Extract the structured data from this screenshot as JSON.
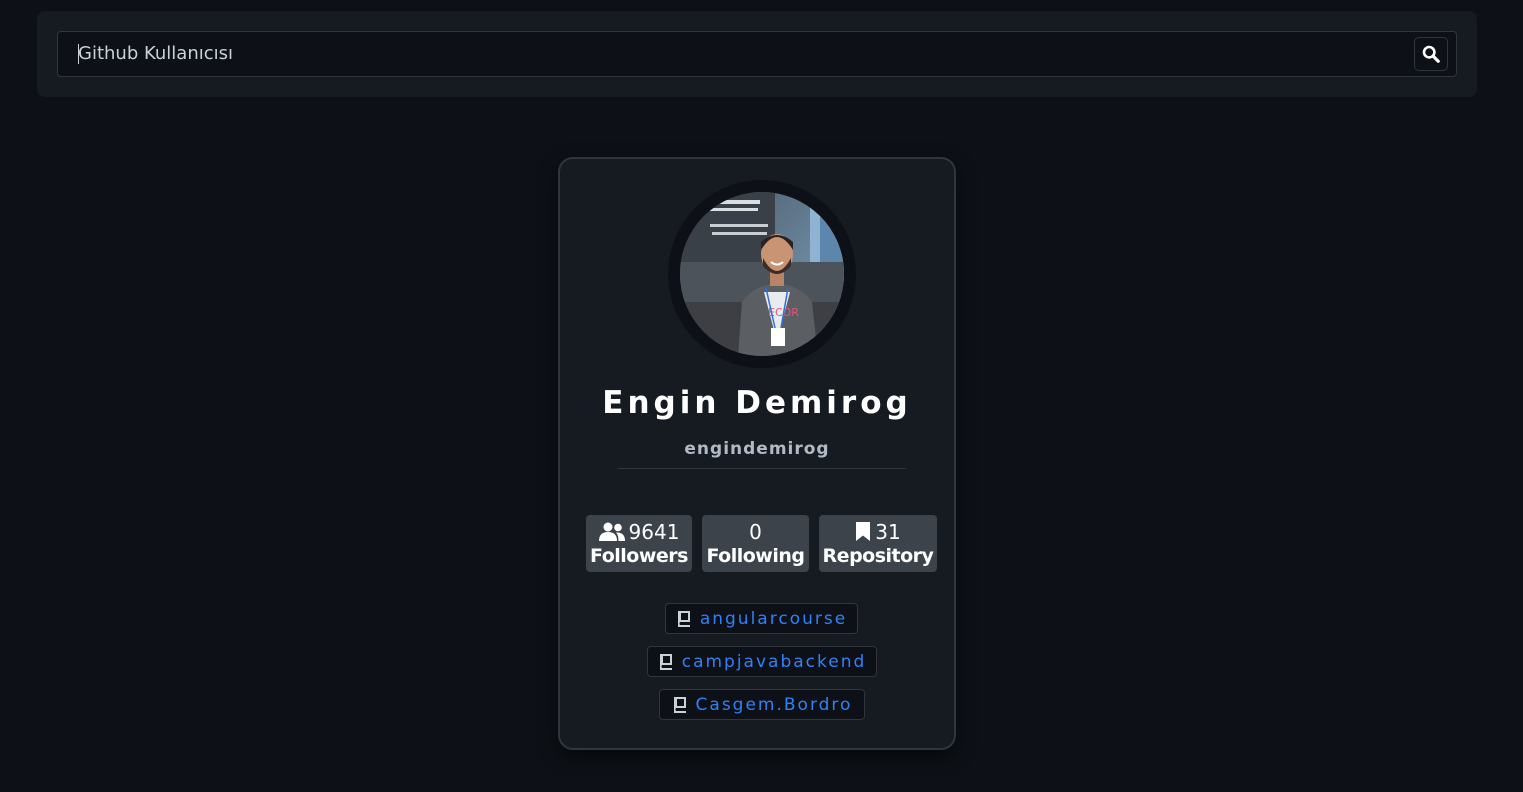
{
  "search": {
    "placeholder": "Github Kullanıcısı"
  },
  "profile": {
    "name": "Engin Demirog",
    "username": "engindemirog",
    "avatar_badge_text": "ECOR"
  },
  "stats": {
    "followers": {
      "value": "9641",
      "label": "Followers"
    },
    "following": {
      "value": "0",
      "label": "Following"
    },
    "repository": {
      "value": "31",
      "label": "Repository"
    }
  },
  "repos": [
    {
      "name": "angularcourse"
    },
    {
      "name": "campjavabackend"
    },
    {
      "name": "Casgem.Bordro"
    }
  ],
  "colors": {
    "background": "#0d1117",
    "panel": "#161b22",
    "border": "#30363d",
    "stat_bg": "#3d434b",
    "link": "#2f81f7"
  }
}
